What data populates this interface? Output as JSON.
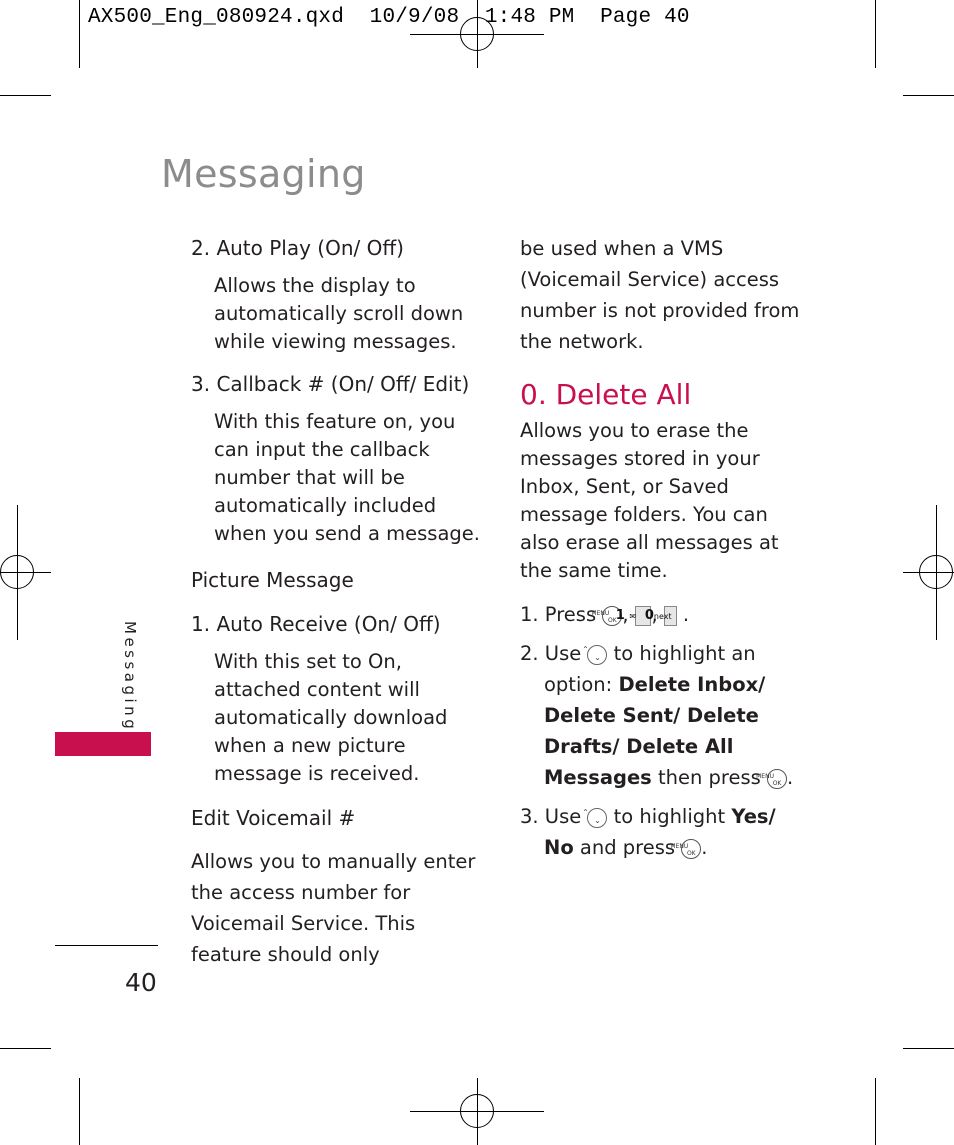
{
  "slug": "AX500_Eng_080924.qxd  10/9/08  1:48 PM  Page 40",
  "page_title": "Messaging",
  "side_tab": {
    "label": "Messaging",
    "accent_color": "#c8104e"
  },
  "page_number": "40",
  "left_column": {
    "auto_play": {
      "heading": "2. Auto Play (On/ Off)",
      "text": "Allows the display to automatically scroll down while viewing messages."
    },
    "callback": {
      "heading": "3. Callback # (On/ Off/ Edit)",
      "text": "With this feature on, you can input the callback number that will be automatically included when you send a message."
    },
    "picture_message": {
      "heading": "Picture Message"
    },
    "auto_receive": {
      "heading": "1. Auto Receive (On/ Off)",
      "text": "With this set to On, attached content will automatically download when a new picture message is received."
    },
    "edit_voicemail": {
      "heading": "Edit Voicemail #",
      "text": "Allows you to manually enter the access number for Voicemail Service. This feature should only"
    }
  },
  "right_column": {
    "continued_text": "be used when a VMS (Voicemail Service) access number is not provided from the network.",
    "delete_all": {
      "heading": "0. Delete All",
      "intro": "Allows you to erase the messages stored in your Inbox, Sent, or Saved message folders. You can also erase all messages at the same time.",
      "steps": {
        "s1_prefix": "1. Press",
        "s2_prefix": "2. Use",
        "s2_mid": "to highlight an option:",
        "s2_options": "Delete Inbox/ Delete Sent/ Delete Drafts/ Delete All Messages",
        "s2_suffix": "then press",
        "s3_prefix": "3. Use",
        "s3_mid": "to highlight",
        "s3_options": "Yes/ No",
        "s3_suffix": "and press"
      }
    }
  },
  "keys": {
    "menu_ok_top": "MENU",
    "menu_ok_bottom": "OK",
    "key1": "1",
    "key1_sub": "✉",
    "key0": "0",
    "key0_sub": "next",
    "nav_up": "⌃",
    "nav_down": "⌄"
  }
}
